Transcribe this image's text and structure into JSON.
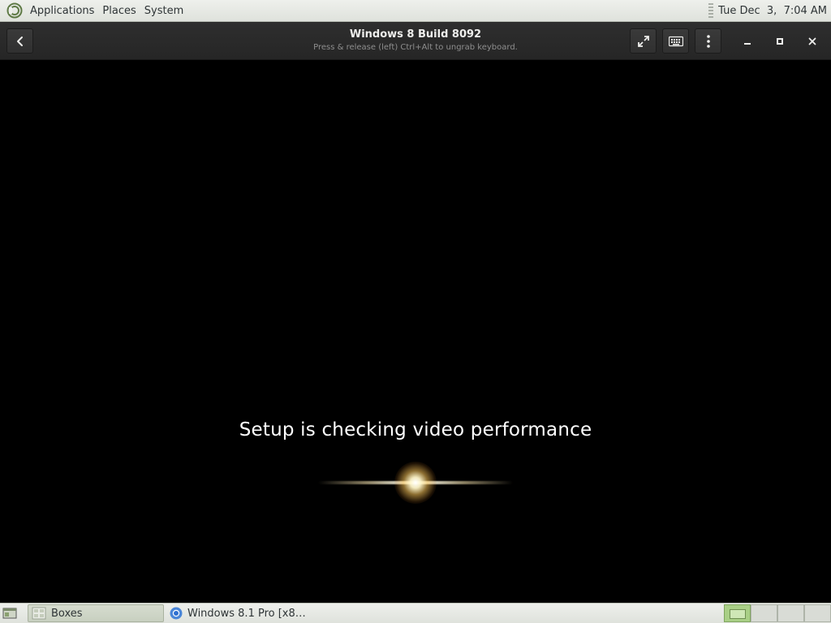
{
  "top_panel": {
    "menus": [
      "Applications",
      "Places",
      "System"
    ],
    "clock": "Tue Dec  3,  7:04 AM",
    "logo_icon": "mate-logo-icon"
  },
  "headerbar": {
    "title": "Windows 8 Build 8092",
    "subtitle": "Press & release (left) Ctrl+Alt to ungrab keyboard.",
    "buttons": {
      "back": "back-icon",
      "fullscreen": "fullscreen-icon",
      "keyboard": "keyboard-icon",
      "menu": "kebab-menu-icon",
      "minimize": "minimize-icon",
      "maximize": "maximize-icon",
      "close": "close-icon"
    }
  },
  "vm": {
    "message": "Setup is checking video performance"
  },
  "bottom_panel": {
    "tasks": [
      {
        "label": "Boxes",
        "icon": "boxes-icon",
        "active": true
      },
      {
        "label": "Windows 8.1 Pro [x8…",
        "icon": "chromium-icon",
        "active": false
      }
    ],
    "workspaces": 4,
    "active_workspace": 1
  },
  "colors": {
    "panel_bg": "#e4e7e1",
    "headerbar_bg": "#2b2b2b",
    "workspace_active": "#a9cf86"
  }
}
